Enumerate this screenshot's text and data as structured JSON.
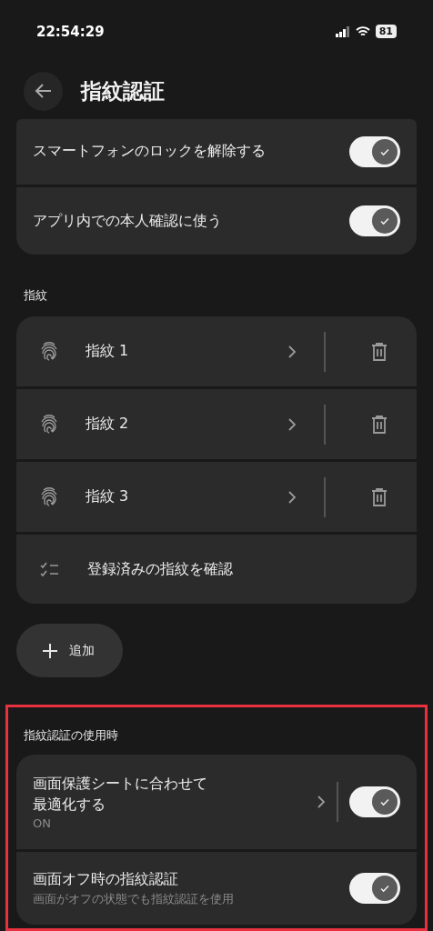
{
  "status_bar": {
    "time": "22:54:29",
    "battery": "81"
  },
  "header": {
    "title": "指紋認証"
  },
  "top_settings": [
    {
      "label": "スマートフォンのロックを解除する",
      "on": true
    },
    {
      "label": "アプリ内での本人確認に使う",
      "on": true
    }
  ],
  "fingerprints": {
    "heading": "指紋",
    "items": [
      {
        "kind": "fingerprint",
        "label": "指紋 1"
      },
      {
        "kind": "fingerprint",
        "label": "指紋 2"
      },
      {
        "kind": "fingerprint",
        "label": "指紋 3"
      },
      {
        "kind": "check",
        "label": "登録済みの指紋を確認"
      }
    ],
    "add_button": "追加"
  },
  "usage": {
    "highlighted": true,
    "heading": "指紋認証の使用時",
    "items": [
      {
        "label": "画面保護シートに合わせて最適化する",
        "sub": "ON",
        "has_chevron": true,
        "on": true
      },
      {
        "label": "画面オフ時の指紋認証",
        "sub": "画面がオフの状態でも指紋認証を使用",
        "has_chevron": false,
        "on": true
      }
    ]
  }
}
